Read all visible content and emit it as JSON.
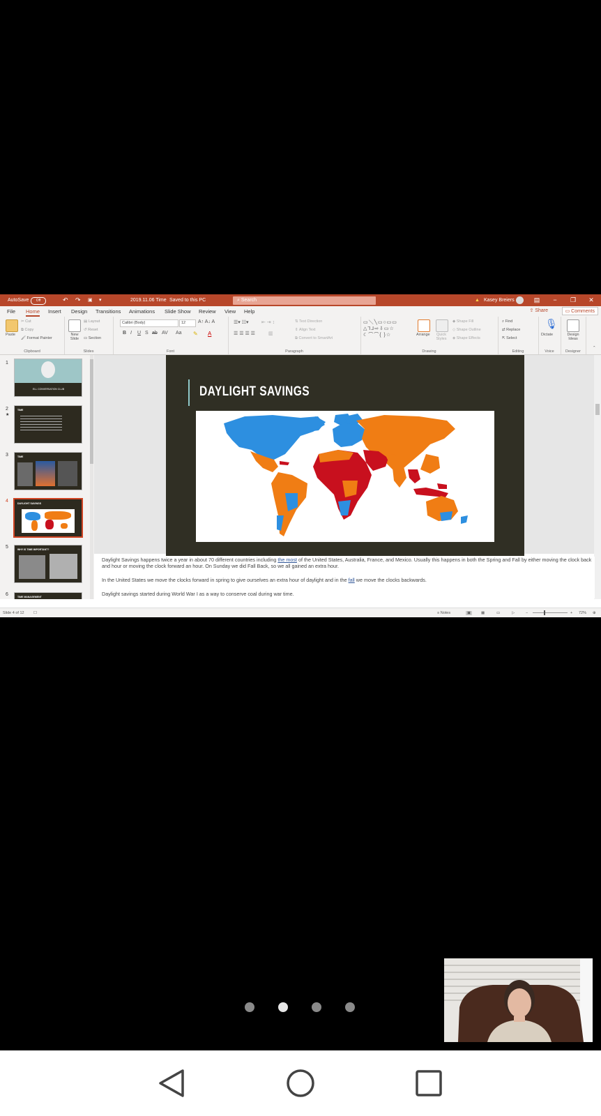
{
  "titlebar": {
    "autosave": "AutoSave",
    "autosave_state": "Off",
    "doc_title": "2019.11.06 Time",
    "save_status": "Saved to this PC",
    "search_placeholder": "Search",
    "user_name": "Kasey Breiers"
  },
  "menu": {
    "items": [
      "File",
      "Home",
      "Insert",
      "Design",
      "Transitions",
      "Animations",
      "Slide Show",
      "Review",
      "View",
      "Help"
    ],
    "active": "Home",
    "share": "Share",
    "comments": "Comments"
  },
  "ribbon": {
    "clipboard": {
      "paste": "Paste",
      "cut": "Cut",
      "copy": "Copy",
      "format_painter": "Format Painter",
      "label": "Clipboard"
    },
    "slides": {
      "new_slide": "New Slide",
      "layout": "Layout",
      "reset": "Reset",
      "section": "Section",
      "label": "Slides"
    },
    "font": {
      "font_name": "Calibri (Body)",
      "font_size": "12",
      "label": "Font"
    },
    "paragraph": {
      "text_direction": "Text Direction",
      "align_text": "Align Text",
      "convert_smartart": "Convert to SmartArt",
      "label": "Paragraph"
    },
    "drawing": {
      "arrange": "Arrange",
      "quick_styles": "Quick Styles",
      "shape_fill": "Shape Fill",
      "shape_outline": "Shape Outline",
      "shape_effects": "Shape Effects",
      "label": "Drawing"
    },
    "editing": {
      "find": "Find",
      "replace": "Replace",
      "select": "Select",
      "label": "Editing"
    },
    "voice": {
      "dictate": "Dictate",
      "label": "Voice"
    },
    "designer": {
      "design_ideas": "Design Ideas",
      "label": "Designer"
    }
  },
  "thumbnails": [
    {
      "num": "1",
      "title": "ELL CONVERSATION CLUB"
    },
    {
      "num": "2",
      "title": "TIME"
    },
    {
      "num": "3",
      "title": "TIME"
    },
    {
      "num": "4",
      "title": "DAYLIGHT SAVINGS"
    },
    {
      "num": "5",
      "title": "WHY IS TIME IMPORTANT?"
    },
    {
      "num": "6",
      "title": "TIME MANAGEMENT"
    }
  ],
  "slide": {
    "title": "DAYLIGHT SAVINGS"
  },
  "notes": {
    "p1_a": "Daylight Savings happens twice a year in about 70 different countries including ",
    "p1_link": "the most",
    "p1_b": " of the United States, Australia, France, and Mexico.  Usually this happens in both the Spring and Fall by either moving the clock back and hour or moving the clock forward an hour.  On Sunday we did Fall Back, so we all gained an extra hour.",
    "p2_a": "In the United States we move the clocks forward in spring to give ourselves an extra hour of daylight and in the ",
    "p2_link": "fall",
    "p2_b": " we move the clocks backwards.",
    "p3": "Daylight savings started during World War I as a way to conserve coal during war time."
  },
  "status": {
    "slide_of": "Slide 4 of 12",
    "notes_btn": "Notes",
    "zoom": "72%"
  },
  "pager": {
    "count": 4,
    "active_index": 1
  }
}
